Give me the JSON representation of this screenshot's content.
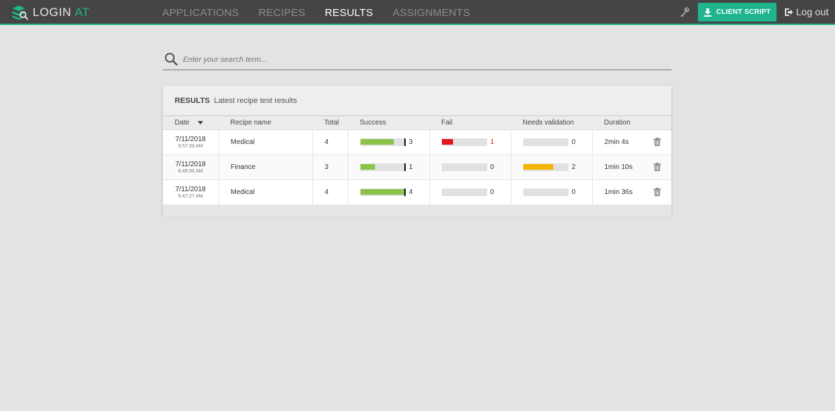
{
  "app": {
    "logo_main": "LOGIN",
    "logo_accent": "AT"
  },
  "nav": {
    "items": [
      {
        "label": "APPLICATIONS",
        "active": false
      },
      {
        "label": "RECIPES",
        "active": false
      },
      {
        "label": "RESULTS",
        "active": true
      },
      {
        "label": "ASSIGNMENTS",
        "active": false
      }
    ],
    "client_script_label": "CLIENT SCRIPT",
    "logout_label": "Log out"
  },
  "search": {
    "placeholder": "Enter your search term..."
  },
  "results": {
    "title": "RESULTS",
    "subtitle": "Latest recipe test results",
    "columns": {
      "date": "Date",
      "recipe": "Recipe name",
      "total": "Total",
      "success": "Success",
      "fail": "Fail",
      "needs": "Needs validation",
      "duration": "Duration"
    },
    "rows": [
      {
        "date": "7/11/2018",
        "time": "6:57:33 AM",
        "recipe": "Medical",
        "total": "4",
        "success": "3",
        "success_frac": 0.75,
        "fail": "1",
        "fail_frac": 0.25,
        "needs": "0",
        "needs_frac": 0,
        "duration": "2min 4s"
      },
      {
        "date": "7/11/2018",
        "time": "6:49:30 AM",
        "recipe": "Finance",
        "total": "3",
        "success": "1",
        "success_frac": 0.33,
        "fail": "0",
        "fail_frac": 0,
        "needs": "2",
        "needs_frac": 0.67,
        "duration": "1min 10s"
      },
      {
        "date": "7/11/2018",
        "time": "6:47:27 AM",
        "recipe": "Medical",
        "total": "4",
        "success": "4",
        "success_frac": 1.0,
        "fail": "0",
        "fail_frac": 0,
        "needs": "0",
        "needs_frac": 0,
        "duration": "1min 36s"
      }
    ]
  },
  "colors": {
    "accent": "#1fb48c",
    "success": "#8bc34a",
    "fail": "#e0161b",
    "needs": "#f5b400",
    "topbar": "#454545"
  }
}
